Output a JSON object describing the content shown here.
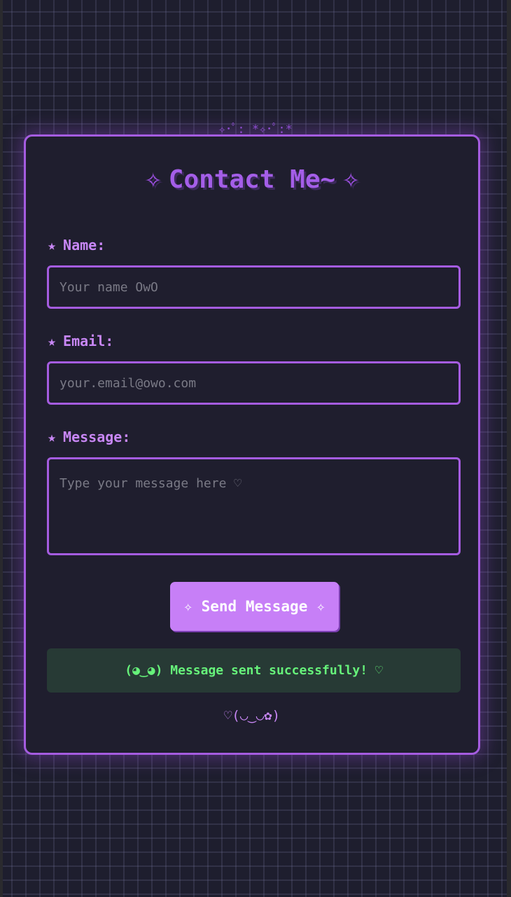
{
  "decoration_top": "✧･ﾟ: *✧･ﾟ:*",
  "form": {
    "title": "Contact Me~",
    "title_sparkle": "✧",
    "label_star": "★",
    "fields": {
      "name": {
        "label": "Name:",
        "placeholder": "Your name OwO",
        "value": ""
      },
      "email": {
        "label": "Email:",
        "placeholder": "your.email@owo.com",
        "value": ""
      },
      "message": {
        "label": "Message:",
        "placeholder": "Type your message here ♡",
        "value": ""
      }
    },
    "submit_label": "✧ Send Message ✧",
    "success_message": "(◕‿◕) Message sent successfully! ♡",
    "footer_kaomoji": "♡(◡‿◡✿)"
  },
  "colors": {
    "background": "#1e1e2e",
    "accent": "#a55ce0",
    "label": "#c887f5",
    "button": "#c77ff7",
    "success_text": "#66f27a",
    "success_bg": "#273a35"
  },
  "icons": {
    "title_sparkle": "sparkle-icon",
    "label_star": "star-icon"
  }
}
